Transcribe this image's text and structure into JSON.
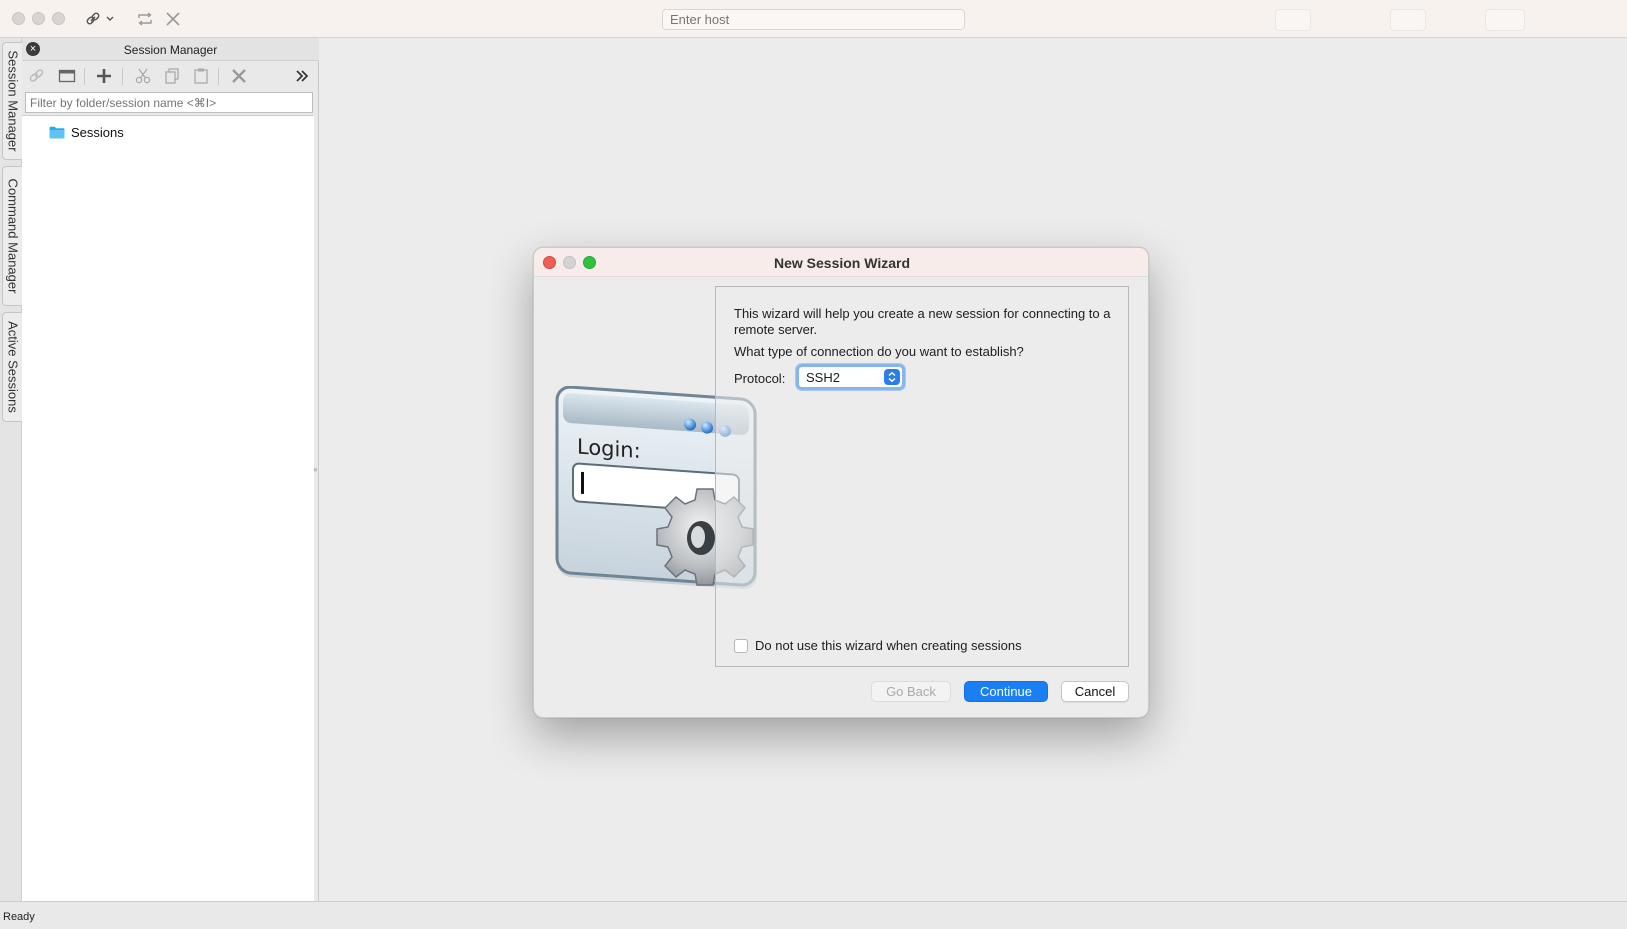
{
  "window": {
    "host_placeholder": "Enter host"
  },
  "side_tabs": [
    {
      "label": "Session Manager"
    },
    {
      "label": "Command Manager"
    },
    {
      "label": "Active Sessions"
    }
  ],
  "session_manager": {
    "title": "Session Manager",
    "filter_placeholder": "Filter by folder/session name <⌘I>",
    "tree": [
      {
        "label": "Sessions",
        "icon": "folder-icon"
      }
    ],
    "toolbar_icons": [
      "connect-icon",
      "window-icon",
      "add-icon",
      "cut-icon",
      "copy-icon",
      "paste-icon",
      "delete-icon",
      "chevron-right-double-icon"
    ]
  },
  "status": {
    "text": "Ready"
  },
  "dialog": {
    "title": "New Session Wizard",
    "intro": "This wizard will help you create a new session for connecting to a remote server.",
    "question": "What type of connection do you want to establish?",
    "protocol_label": "Protocol:",
    "protocol_value": "SSH2",
    "illustration_text": "Login:",
    "checkbox_label": "Do not use this wizard when creating sessions",
    "checkbox_checked": false,
    "buttons": {
      "back": "Go Back",
      "continue": "Continue",
      "cancel": "Cancel"
    }
  },
  "colors": {
    "accent": "#1a7ff5",
    "close_red": "#ed5f57",
    "minimize_grey": "#d3d3d3",
    "zoom_green": "#30c140"
  }
}
